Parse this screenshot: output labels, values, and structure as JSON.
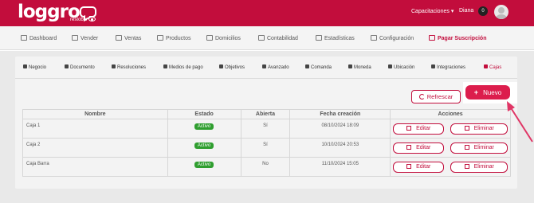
{
  "brand": {
    "name": "loggro",
    "subtitle": "restobar"
  },
  "topbar": {
    "capacitaciones": "Capacitaciones",
    "user": "Diana",
    "notifications": "0"
  },
  "nav": [
    {
      "label": "Dashboard",
      "icon": "dashboard-icon"
    },
    {
      "label": "Vender",
      "icon": "cart-icon"
    },
    {
      "label": "Ventas",
      "icon": "tag-icon"
    },
    {
      "label": "Productos",
      "icon": "box-icon"
    },
    {
      "label": "Domicilios",
      "icon": "bike-icon"
    },
    {
      "label": "Contabilidad",
      "icon": "building-icon"
    },
    {
      "label": "Estadísticas",
      "icon": "chart-icon"
    },
    {
      "label": "Configuración",
      "icon": "gear-icon"
    },
    {
      "label": "Pagar Suscripción",
      "icon": "card-icon"
    }
  ],
  "subtabs": [
    {
      "label": "Negocio"
    },
    {
      "label": "Documento"
    },
    {
      "label": "Resoluciones"
    },
    {
      "label": "Medios de pago"
    },
    {
      "label": "Objetivos"
    },
    {
      "label": "Avanzado"
    },
    {
      "label": "Comanda"
    },
    {
      "label": "Moneda"
    },
    {
      "label": "Ubicación"
    },
    {
      "label": "Integraciones"
    },
    {
      "label": "Cajas"
    }
  ],
  "buttons": {
    "refresh": "Refrescar",
    "new": "Nuevo",
    "edit": "Editar",
    "delete": "Eliminar"
  },
  "table": {
    "headers": [
      "Nombre",
      "Estado",
      "Abierta",
      "Fecha creación",
      "Acciones"
    ],
    "rows": [
      {
        "name": "Caja 1",
        "status": "Activo",
        "open": "Sí",
        "date": "08/10/2024 18:09"
      },
      {
        "name": "Caja 2",
        "status": "Activo",
        "open": "Sí",
        "date": "10/10/2024 20:53"
      },
      {
        "name": "Caja Barra",
        "status": "Activo",
        "open": "No",
        "date": "11/10/2024 15:05"
      }
    ]
  },
  "colors": {
    "brand": "#c20d3c",
    "active_status": "#2f9e2f",
    "new_button": "#dc1d4c"
  }
}
